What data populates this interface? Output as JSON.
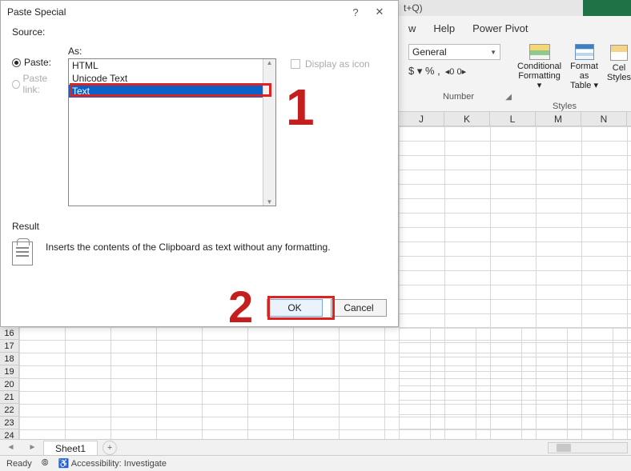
{
  "dialog": {
    "title": "Paste Special",
    "source_label": "Source:",
    "as_label": "As:",
    "paste_label": "Paste:",
    "paste_link_label": "Paste link:",
    "list": {
      "item0": "HTML",
      "item1": "Unicode Text",
      "item2": "Text"
    },
    "display_as_icon": "Display as icon",
    "result_label": "Result",
    "result_desc": "Inserts the contents of the Clipboard as text without any formatting.",
    "ok": "OK",
    "cancel": "Cancel",
    "help_glyph": "?",
    "close_glyph": "✕"
  },
  "annotations": {
    "one": "1",
    "two": "2"
  },
  "ribbon": {
    "title_remnant": "t+Q)",
    "tab_view_suffix": "w",
    "tab_help": "Help",
    "tab_powerpivot": "Power Pivot",
    "num_format": "General",
    "num_symbols": "$  ▾   %   ,",
    "num_dec": "◂0  0▸",
    "num_group": "Number",
    "cond_fmt_l1": "Conditional",
    "cond_fmt_l2": "Formatting ▾",
    "fmt_tbl_l1": "Format as",
    "fmt_tbl_l2": "Table ▾",
    "cell_styles_l1": "Cel",
    "cell_styles_l2": "Styles",
    "styles_group": "Styles"
  },
  "cols": {
    "c0": "J",
    "c1": "K",
    "c2": "L",
    "c3": "M",
    "c4": "N"
  },
  "rows": {
    "r16": "16",
    "r17": "17",
    "r18": "18",
    "r19": "19",
    "r20": "20",
    "r21": "21",
    "r22": "22",
    "r23": "23",
    "r24": "24"
  },
  "sheet": {
    "name": "Sheet1",
    "add": "+"
  },
  "status": {
    "ready": "Ready",
    "acc": "Accessibility: Investigate"
  }
}
